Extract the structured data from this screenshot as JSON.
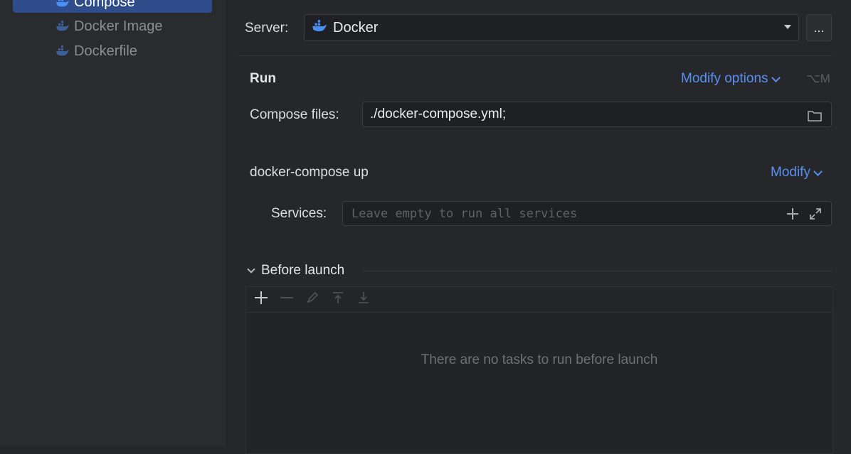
{
  "sidebar": {
    "items": [
      {
        "label": "Compose",
        "icon": "docker-whale-icon",
        "selected": true
      },
      {
        "label": "Docker Image",
        "icon": "docker-whale-icon",
        "selected": false
      },
      {
        "label": "Dockerfile",
        "icon": "docker-whale-icon",
        "selected": false
      }
    ]
  },
  "server": {
    "label": "Server:",
    "value": "Docker",
    "more_label": "..."
  },
  "run": {
    "title": "Run",
    "modify_options_label": "Modify options",
    "shortcut": "⌥M",
    "compose_files_label": "Compose files:",
    "compose_files_value": "./docker-compose.yml;"
  },
  "compose_up": {
    "title": "docker-compose up",
    "modify_label": "Modify",
    "services_label": "Services:",
    "services_placeholder": "Leave empty to run all services"
  },
  "before_launch": {
    "title": "Before launch",
    "empty_text": "There are no tasks to run before launch"
  },
  "colors": {
    "accent": "#5a8ff0",
    "selection": "#2e4d8a",
    "docker_blue": "#4a8ff5"
  }
}
